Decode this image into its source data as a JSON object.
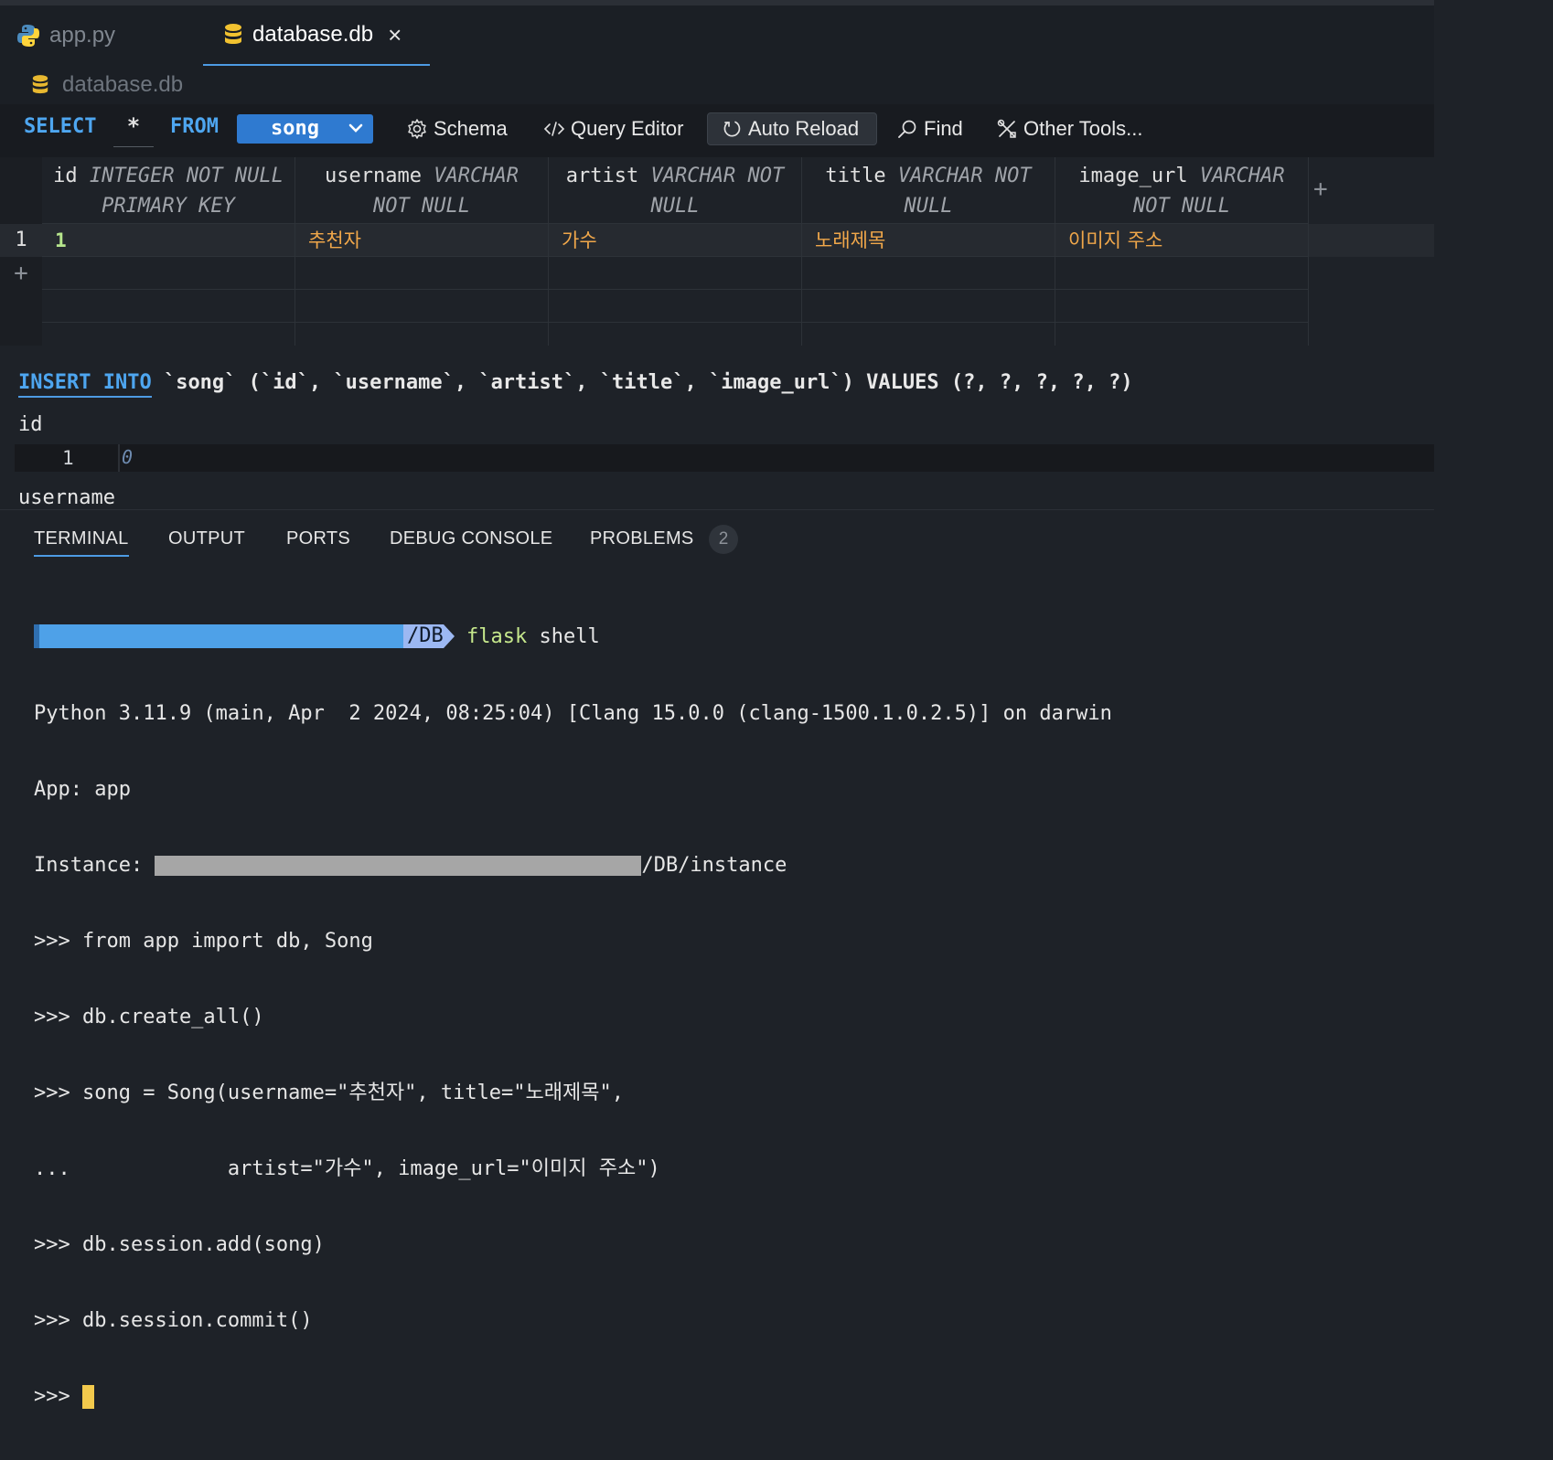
{
  "tabs": [
    {
      "label": "app.py",
      "icon": "python-icon"
    },
    {
      "label": "database.db",
      "icon": "database-icon"
    }
  ],
  "breadcrumb": {
    "label": "database.db"
  },
  "toolbar": {
    "select_kw": "SELECT",
    "columns": "*",
    "from_kw": "FROM",
    "table": "song",
    "schema": "Schema",
    "query_editor": "Query Editor",
    "auto_reload": "Auto Reload",
    "find": "Find",
    "other_tools": "Other Tools..."
  },
  "grid": {
    "columns": [
      {
        "name": "id",
        "type_l1": "INTEGER NOT NULL",
        "type_l2": "PRIMARY KEY"
      },
      {
        "name": "username",
        "type_l1": "VARCHAR",
        "type_l2": "NOT NULL"
      },
      {
        "name": "artist",
        "type_l1": "VARCHAR NOT",
        "type_l2": "NULL"
      },
      {
        "name": "title",
        "type_l1": "VARCHAR NOT",
        "type_l2": "NULL"
      },
      {
        "name": "image_url",
        "type_l1": "VARCHAR",
        "type_l2": "NOT NULL"
      }
    ],
    "rows": [
      {
        "rownum": "1",
        "id": "1",
        "username": "추천자",
        "artist": "가수",
        "title": "노래제목",
        "image_url": "이미지 주소"
      }
    ],
    "add_row": "+",
    "add_col": "+"
  },
  "insert": {
    "keyword": "INSERT INTO",
    "statement": " `song` (`id`, `username`, `artist`, `title`, `image_url`) VALUES (?, ?, ?, ?, ?)",
    "field_id": "id",
    "line_no": "1",
    "value_placeholder": "0",
    "field_username": "username"
  },
  "panel": {
    "tabs": [
      "TERMINAL",
      "OUTPUT",
      "PORTS",
      "DEBUG CONSOLE",
      "PROBLEMS"
    ],
    "problems_count": "2"
  },
  "terminal": {
    "prompt_path": "/DB",
    "prompt_cmd_1": "flask",
    "prompt_cmd_2": " shell",
    "lines": [
      "Python 3.11.9 (main, Apr  2 2024, 08:25:04) [Clang 15.0.0 (clang-1500.1.0.2.5)] on darwin",
      "App: app"
    ],
    "instance_label": "Instance: ",
    "instance_suffix": "/DB/instance",
    "lines2": [
      ">>> from app import db, Song",
      ">>> db.create_all()",
      ">>> song = Song(username=\"추천자\", title=\"노래제목\",",
      "...             artist=\"가수\", image_url=\"이미지 주소\")",
      ">>> db.session.add(song)",
      ">>> db.session.commit()"
    ],
    "final_prompt": ">>> "
  },
  "colors": {
    "accent": "#4d9be3",
    "number": "#b6e58c",
    "string": "#f0a74a",
    "cursor": "#f2c94c"
  }
}
